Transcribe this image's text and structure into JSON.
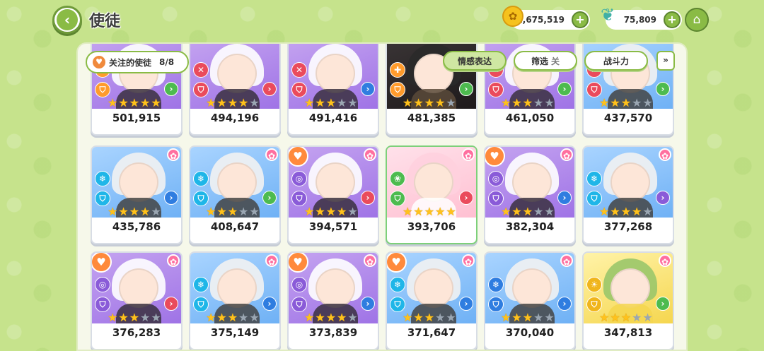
{
  "header": {
    "title": "使徒",
    "back_icon": "‹"
  },
  "currency": {
    "coins": "1,675,519",
    "gems": "75,809",
    "coin_icon": "coin-icon",
    "gem_icon": "leaf-gem-icon"
  },
  "filters": {
    "follow_label": "关注的使徒",
    "follow_count": "8/8",
    "emotion_label": "情感表达",
    "filter_label": "筛选",
    "filter_state": "关",
    "power_label": "战斗力",
    "sort_icon": "»"
  },
  "rows": [
    {
      "cards": [
        {
          "power": "501,915",
          "bg": "purple",
          "attr": "cross",
          "attr_color": "a-orange",
          "arrow_color": "a-green",
          "stars": 5,
          "fav": false,
          "flower": false
        },
        {
          "power": "494,196",
          "bg": "purple",
          "attr": "sword",
          "attr_color": "a-red",
          "arrow_color": "a-red",
          "stars": 4,
          "fav": false,
          "flower": false
        },
        {
          "power": "491,416",
          "bg": "purple",
          "attr": "sword",
          "attr_color": "a-red",
          "arrow_color": "a-blue",
          "stars": 3,
          "fav": false,
          "flower": false
        },
        {
          "power": "481,385",
          "bg": "dark",
          "attr": "cross",
          "attr_color": "a-orange",
          "arrow_color": "a-green",
          "stars": 4,
          "fav": false,
          "flower": false
        },
        {
          "power": "461,050",
          "bg": "purple",
          "attr": "sword",
          "attr_color": "a-red",
          "arrow_color": "a-green",
          "stars": 3,
          "fav": false,
          "flower": false
        },
        {
          "power": "437,570",
          "bg": "blue",
          "attr": "sword",
          "attr_color": "a-red",
          "arrow_color": "a-green",
          "stars": 3,
          "fav": false,
          "flower": false
        }
      ]
    },
    {
      "cards": [
        {
          "power": "435,786",
          "bg": "blue",
          "attr": "snow",
          "attr_color": "a-cyan",
          "arrow_color": "a-blue",
          "stars": 4,
          "fav": false,
          "flower": true
        },
        {
          "power": "408,647",
          "bg": "blue",
          "attr": "snow",
          "attr_color": "a-cyan",
          "arrow_color": "a-green",
          "stars": 3,
          "fav": false,
          "flower": true
        },
        {
          "power": "394,571",
          "bg": "purple",
          "attr": "swirl",
          "attr_color": "a-purple",
          "arrow_color": "a-red",
          "stars": 4,
          "fav": true,
          "flower": true
        },
        {
          "power": "393,706",
          "bg": "pink",
          "attr": "leaf",
          "attr_color": "a-green",
          "arrow_color": "a-red",
          "stars": 5,
          "fav": false,
          "flower": true,
          "selected": true
        },
        {
          "power": "382,304",
          "bg": "purple",
          "attr": "swirl",
          "attr_color": "a-purple",
          "arrow_color": "a-blue",
          "stars": 3,
          "fav": true,
          "flower": true
        },
        {
          "power": "377,268",
          "bg": "blue",
          "attr": "snow",
          "attr_color": "a-cyan",
          "arrow_color": "a-purple",
          "stars": 4,
          "fav": false,
          "flower": true
        }
      ]
    },
    {
      "cards": [
        {
          "power": "376,283",
          "bg": "purple",
          "attr": "swirl",
          "attr_color": "a-purple",
          "arrow_color": "a-red",
          "stars": 3,
          "fav": true,
          "flower": true
        },
        {
          "power": "375,149",
          "bg": "blue",
          "attr": "snow",
          "attr_color": "a-cyan",
          "arrow_color": "a-blue",
          "stars": 3,
          "fav": false,
          "flower": true
        },
        {
          "power": "373,839",
          "bg": "purple",
          "attr": "swirl",
          "attr_color": "a-purple",
          "arrow_color": "a-blue",
          "stars": 4,
          "fav": true,
          "flower": true
        },
        {
          "power": "371,647",
          "bg": "blue",
          "attr": "snow",
          "attr_color": "a-cyan",
          "arrow_color": "a-blue",
          "stars": 3,
          "fav": true,
          "flower": true
        },
        {
          "power": "370,040",
          "bg": "blue",
          "attr": "snow",
          "attr_color": "a-blue",
          "arrow_color": "a-blue",
          "stars": 3,
          "fav": false,
          "flower": true
        },
        {
          "power": "347,813",
          "bg": "yellow",
          "attr": "sun",
          "attr_color": "a-yellow",
          "arrow_color": "a-green",
          "stars": 3,
          "fav": false,
          "flower": true
        }
      ]
    }
  ],
  "colors": {
    "background": "#c6e38c",
    "accent_green": "#8abb45",
    "panel": "#f6f8ea",
    "star_on": "#ffc21c",
    "star_off": "#9aa6b2"
  }
}
